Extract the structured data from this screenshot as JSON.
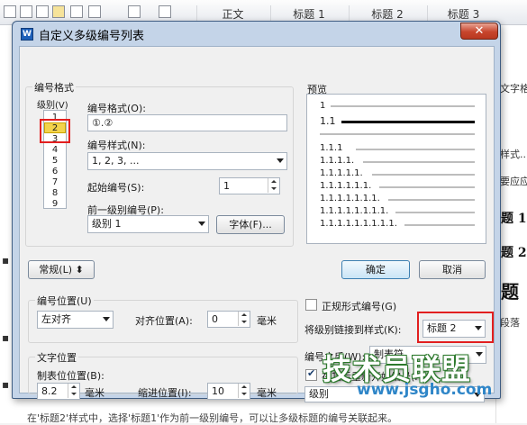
{
  "background": {
    "toolbar_styles": [
      "正文",
      "标题 1",
      "标题 2",
      "标题 3"
    ],
    "right_panel": {
      "items": [
        "文字格",
        "样式...",
        "要应应",
        "段落"
      ],
      "headings": [
        "题 1",
        "题 2",
        "题"
      ]
    },
    "bottom_text": "在'标题2'样式中，选择'标题1'作为前一级别编号，可以让多级标题的编号关联起来。"
  },
  "dialog": {
    "title": "自定义多级编号列表",
    "app_icon": "W",
    "close_label": "✕",
    "number_format_group": "编号格式",
    "level_label": "级别(V)",
    "levels": [
      "1",
      "2",
      "3",
      "4",
      "5",
      "6",
      "7",
      "8",
      "9"
    ],
    "selected_level": "2",
    "format_label": "编号格式(O):",
    "format_value": "①.②",
    "style_label": "编号样式(N):",
    "style_value": "1, 2, 3, ...",
    "start_label": "起始编号(S):",
    "start_value": "1",
    "prev_level_label": "前一级别编号(P):",
    "prev_level_value": "级别 1",
    "font_button": "字体(F)...",
    "preview_label": "预览",
    "preview_rows": [
      "1",
      "1.1",
      "1.1.1",
      "1.1.1.1.",
      "1.1.1.1.1.",
      "1.1.1.1.1.1.",
      "1.1.1.1.1.1.1.",
      "1.1.1.1.1.1.1.1.",
      "1.1.1.1.1.1.1.1.1."
    ],
    "general_button": "常规(L)",
    "ok_button": "确定",
    "cancel_button": "取消",
    "position_group": "编号位置(U)",
    "alignment_value": "左对齐",
    "align_pos_label": "对齐位置(A):",
    "align_pos_value": "0",
    "unit_mm": "毫米",
    "text_position_group": "文字位置",
    "tab_pos_label": "制表位位置(B):",
    "tab_pos_value": "8.2",
    "indent_label": "缩进位置(I):",
    "indent_value": "10",
    "legal_style_label": "正规形式编号(G)",
    "link_style_label": "将级别链接到样式(K):",
    "link_style_value": "标题 2",
    "after_number_label": "编号之后(W):",
    "after_number_value": "制表符",
    "restart_label": "在其后重新开始编号(R):",
    "restart_value": "级别"
  },
  "watermark": {
    "main": "技术员联盟",
    "sub": "www.jsgho.com"
  },
  "colors": {
    "highlight_red": "#e21f1f",
    "selected_level_yellow": "#f3d34b"
  }
}
